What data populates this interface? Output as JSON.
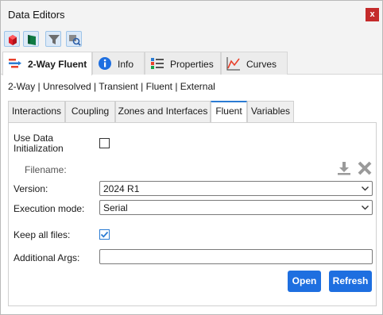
{
  "window": {
    "title": "Data Editors",
    "close_symbol": "x"
  },
  "toolbar": {
    "icons": [
      "red-cube-icon",
      "green-flag-icon",
      "filter-icon",
      "search-settings-icon"
    ]
  },
  "main_tabs": [
    {
      "label": "2-Way Fluent",
      "icon": "coupling-icon",
      "active": true
    },
    {
      "label": "Info",
      "icon": "info-icon",
      "active": false
    },
    {
      "label": "Properties",
      "icon": "properties-icon",
      "active": false
    },
    {
      "label": "Curves",
      "icon": "curves-icon",
      "active": false
    }
  ],
  "status_line": "2-Way | Unresolved | Transient | Fluent | External",
  "sub_tabs": [
    {
      "label": "Interactions",
      "active": false
    },
    {
      "label": "Coupling",
      "active": false
    },
    {
      "label": "Zones and Interfaces",
      "active": false
    },
    {
      "label": "Fluent",
      "active": true
    },
    {
      "label": "Variables",
      "active": false
    }
  ],
  "form": {
    "use_data_init_label_line1": "Use Data",
    "use_data_init_label_line2": "Initialization",
    "use_data_init_checked": false,
    "filename_label": "Filename:",
    "version_label": "Version:",
    "version_value": "2024 R1",
    "execution_mode_label": "Execution mode:",
    "execution_mode_value": "Serial",
    "keep_files_label": "Keep all files:",
    "keep_files_checked": true,
    "additional_args_label": "Additional Args:",
    "additional_args_value": ""
  },
  "buttons": {
    "open": "Open",
    "refresh": "Refresh"
  },
  "colors": {
    "accent": "#1e6fe0",
    "close": "#c42b2b"
  }
}
